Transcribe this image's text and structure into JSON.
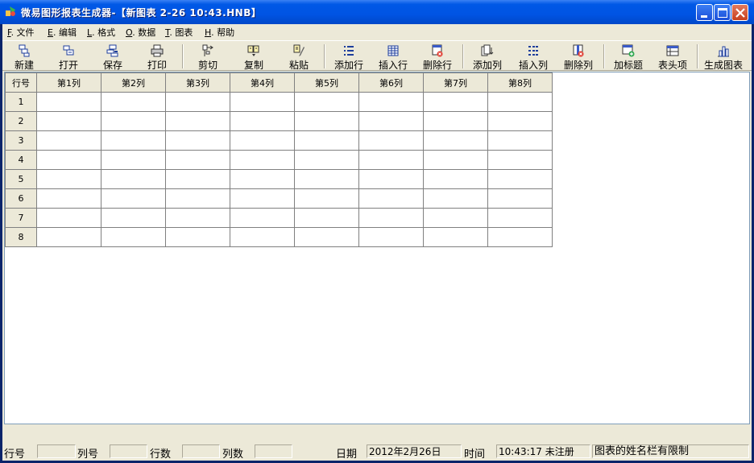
{
  "window": {
    "title": "微易图形报表生成器-【新图表 2-26 10:43.HNB】"
  },
  "menu": [
    {
      "accel": "F",
      "label": ". 文件"
    },
    {
      "accel": "E",
      "label": ". 编辑"
    },
    {
      "accel": "L",
      "label": ". 格式"
    },
    {
      "accel": "O",
      "label": ". 数据"
    },
    {
      "accel": "T",
      "label": ". 图表"
    },
    {
      "accel": "H",
      "label": ". 帮助"
    }
  ],
  "toolbar": {
    "new": "新建",
    "open": "打开",
    "save": "保存",
    "print": "打印",
    "cut": "剪切",
    "copy": "复制",
    "paste": "粘贴",
    "add_row": "添加行",
    "insert_row": "插入行",
    "delete_row": "删除行",
    "add_col": "添加列",
    "insert_col": "插入列",
    "delete_col": "删除列",
    "add_title": "加标题",
    "header_item": "表头项",
    "gen_chart": "生成图表"
  },
  "grid": {
    "corner": "行号",
    "columns": [
      "第1列",
      "第2列",
      "第3列",
      "第4列",
      "第5列",
      "第6列",
      "第7列",
      "第8列"
    ],
    "rows": [
      "1",
      "2",
      "3",
      "4",
      "5",
      "6",
      "7",
      "8"
    ]
  },
  "status": {
    "row_label": "行号",
    "row_value": "",
    "col_label": "列号",
    "col_value": "",
    "rows_label": "行数",
    "rows_value": "",
    "cols_label": "列数",
    "cols_value": "",
    "date_label": "日期",
    "date_value": "2012年2月26日",
    "time_label": "时间",
    "time_value": "10:43:17 未注册",
    "notice": "图表的姓名栏有限制"
  }
}
